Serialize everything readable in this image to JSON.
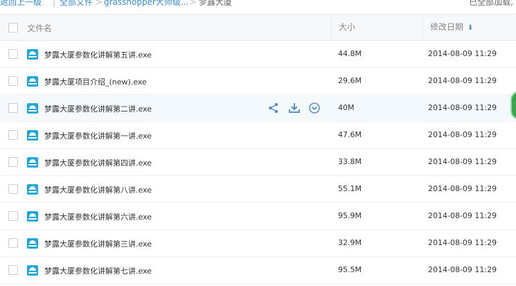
{
  "breadcrumb": {
    "back": "返回上一级",
    "sep1": "|",
    "all_files": "全部文件",
    "sep2": ">",
    "folder1": "grasshopper大师级...",
    "sep3": ">",
    "current": "梦露大厦"
  },
  "status": {
    "loaded": "已全部加载,"
  },
  "header": {
    "name": "文件名",
    "size": "大小",
    "date": "修改日期"
  },
  "icons": {
    "file": "exe-file-icon",
    "share": "share-icon",
    "download": "download-icon",
    "more": "more-icon",
    "sort": "sort-down-icon"
  },
  "colors": {
    "accent": "#3b8cd1",
    "file_icon": "#1aa8d8",
    "hover_row": "#f4f9fe"
  },
  "files": [
    {
      "name": "梦露大厦参数化讲解第五讲.exe",
      "size": "44.8M",
      "date": "2014-08-09 11:29"
    },
    {
      "name": "梦露大厦项目介绍_(new).exe",
      "size": "29.6M",
      "date": "2014-08-09 11:29"
    },
    {
      "name": "梦露大厦参数化讲解第二讲.exe",
      "size": "40M",
      "date": "2014-08-09 11:29"
    },
    {
      "name": "梦露大厦参数化讲解第一讲.exe",
      "size": "47.6M",
      "date": "2014-08-09 11:29"
    },
    {
      "name": "梦露大厦参数化讲解第四讲.exe",
      "size": "33.8M",
      "date": "2014-08-09 11:29"
    },
    {
      "name": "梦露大厦参数化讲解第八讲.exe",
      "size": "55.1M",
      "date": "2014-08-09 11:29"
    },
    {
      "name": "梦露大厦参数化讲解第六讲.exe",
      "size": "95.9M",
      "date": "2014-08-09 11:29"
    },
    {
      "name": "梦露大厦参数化讲解第三讲.exe",
      "size": "32.9M",
      "date": "2014-08-09 11:29"
    },
    {
      "name": "梦露大厦参数化讲解第七讲.exe",
      "size": "95.5M",
      "date": "2014-08-09 11:29"
    }
  ]
}
